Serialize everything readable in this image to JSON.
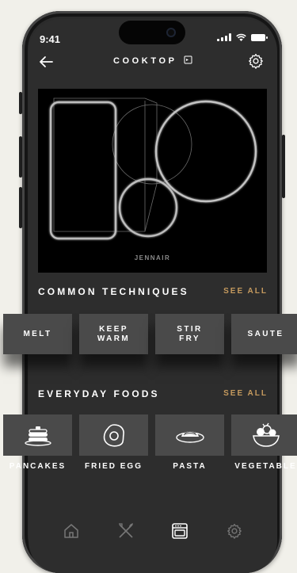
{
  "status": {
    "time": "9:41"
  },
  "header": {
    "title": "COOKTOP"
  },
  "cooktop": {
    "brand": "JENNAIR"
  },
  "techniques": {
    "title": "COMMON TECHNIQUES",
    "see_all": "SEE ALL",
    "items": [
      {
        "label": "MELT"
      },
      {
        "label": "KEEP\nWARM"
      },
      {
        "label": "STIR\nFRY"
      },
      {
        "label": "SAUTE"
      }
    ]
  },
  "foods": {
    "title": "EVERYDAY FOODS",
    "see_all": "SEE ALL",
    "items": [
      {
        "label": "PANCAKES",
        "icon": "pancakes-icon"
      },
      {
        "label": "FRIED EGG",
        "icon": "fried-egg-icon"
      },
      {
        "label": "PASTA",
        "icon": "pasta-icon"
      },
      {
        "label": "VEGETABLE",
        "icon": "vegetable-icon"
      }
    ]
  },
  "nav": {
    "items": [
      {
        "icon": "home-icon",
        "active": false
      },
      {
        "icon": "utensils-icon",
        "active": false
      },
      {
        "icon": "oven-icon",
        "active": true
      },
      {
        "icon": "settings-icon",
        "active": false
      }
    ]
  },
  "colors": {
    "accent": "#c59a5e",
    "tile": "#4a4a4a",
    "screen": "#2d2d2d",
    "page": "#f1f0ea"
  }
}
